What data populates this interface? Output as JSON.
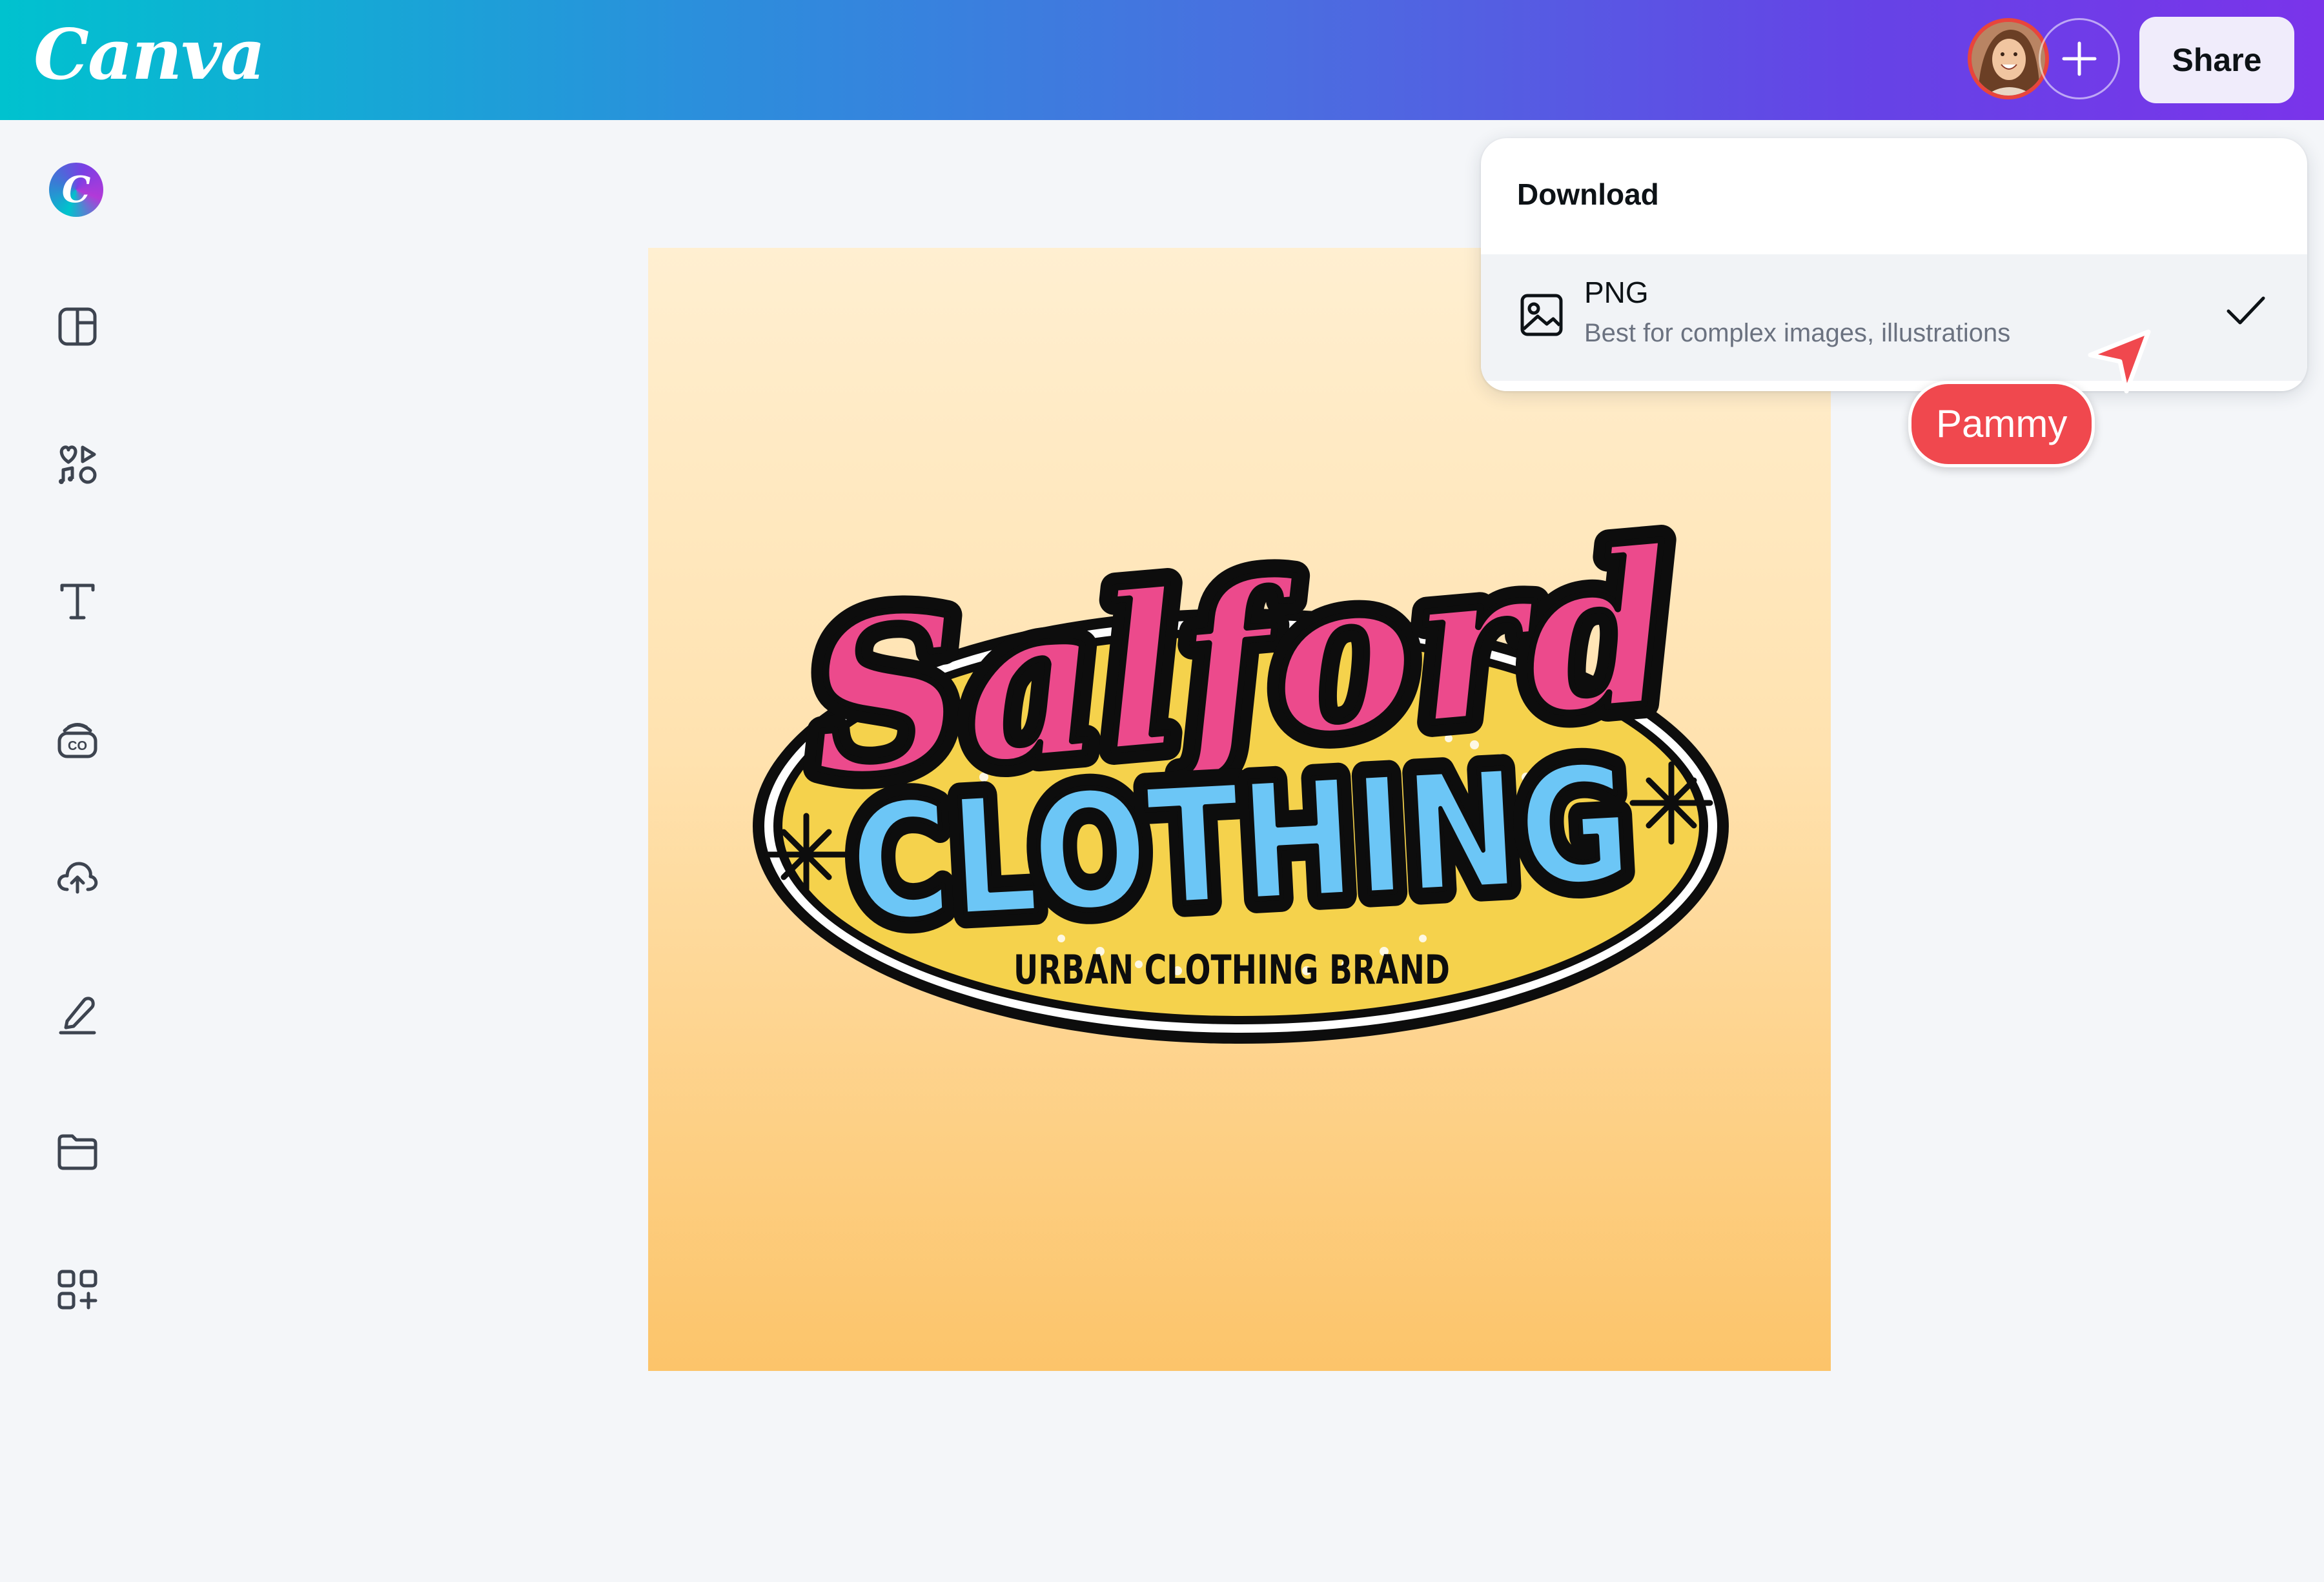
{
  "app": {
    "logo_text": "Canva"
  },
  "header": {
    "share_label": "Share",
    "avatar_icon": "user-avatar",
    "add_icon": "plus-icon"
  },
  "sidebar": {
    "items": [
      {
        "icon": "canva-magic-icon"
      },
      {
        "icon": "design-templates-icon"
      },
      {
        "icon": "elements-icon"
      },
      {
        "icon": "text-icon"
      },
      {
        "icon": "brand-kit-icon"
      },
      {
        "icon": "uploads-icon"
      },
      {
        "icon": "draw-icon"
      },
      {
        "icon": "projects-folder-icon"
      },
      {
        "icon": "apps-icon"
      }
    ]
  },
  "design": {
    "logo_script": "Salford",
    "logo_block": "CLOTHING",
    "logo_tagline": "URBAN CLOTHING BRAND",
    "colors": {
      "script": "#ec4a8c",
      "block": "#6cc6f6",
      "oval": "#f5d24c",
      "outline": "#0d0d0d",
      "background_top": "#ffefd1",
      "background_bottom": "#fcc46a"
    }
  },
  "download_menu": {
    "title": "Download",
    "format": {
      "name": "PNG",
      "description": "Best for complex images, illustrations",
      "icon": "image-icon",
      "selected_icon": "check-icon"
    }
  },
  "collaborator": {
    "name": "Pammy",
    "color": "#f0484e"
  }
}
